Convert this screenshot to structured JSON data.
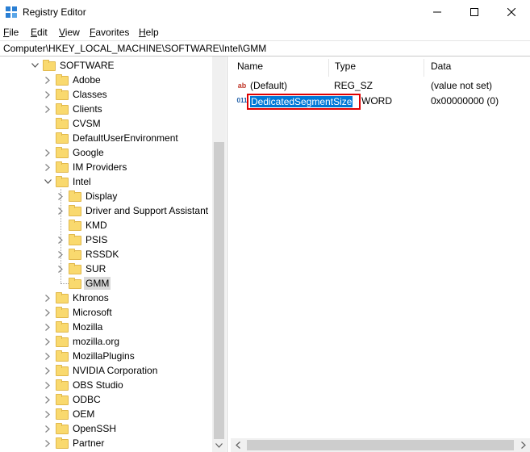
{
  "window": {
    "title": "Registry Editor",
    "controls": {
      "minimize": "minimize",
      "maximize": "maximize",
      "close": "close"
    }
  },
  "menu": [
    {
      "label": "File"
    },
    {
      "label": "Edit"
    },
    {
      "label": "View"
    },
    {
      "label": "Favorites"
    },
    {
      "label": "Help"
    }
  ],
  "address": "Computer\\HKEY_LOCAL_MACHINE\\SOFTWARE\\Intel\\GMM",
  "tree": {
    "items": [
      {
        "label": "SOFTWARE",
        "expanded": true
      },
      {
        "label": "Adobe"
      },
      {
        "label": "Classes"
      },
      {
        "label": "Clients"
      },
      {
        "label": "CVSM"
      },
      {
        "label": "DefaultUserEnvironment"
      },
      {
        "label": "Google"
      },
      {
        "label": "IM Providers"
      },
      {
        "label": "Intel",
        "expanded": true
      },
      {
        "label": "Display"
      },
      {
        "label": "Driver and Support Assistant"
      },
      {
        "label": "KMD"
      },
      {
        "label": "PSIS"
      },
      {
        "label": "RSSDK"
      },
      {
        "label": "SUR"
      },
      {
        "label": "GMM",
        "selected": true
      },
      {
        "label": "Khronos"
      },
      {
        "label": "Microsoft"
      },
      {
        "label": "Mozilla"
      },
      {
        "label": "mozilla.org"
      },
      {
        "label": "MozillaPlugins"
      },
      {
        "label": "NVIDIA Corporation"
      },
      {
        "label": "OBS Studio"
      },
      {
        "label": "ODBC"
      },
      {
        "label": "OEM"
      },
      {
        "label": "OpenSSH"
      },
      {
        "label": "Partner"
      }
    ]
  },
  "list": {
    "columns": {
      "name": "Name",
      "type": "Type",
      "data": "Data"
    },
    "rows": [
      {
        "icon": "string-value-icon",
        "name": "(Default)",
        "type": "REG_SZ",
        "data": "(value not set)"
      },
      {
        "icon": "dword-value-icon",
        "name": "DedicatedSegmentSize",
        "type": "WORD",
        "data": "0x00000000 (0)",
        "editing": true
      }
    ]
  },
  "colors": {
    "selection": "#0078d7",
    "highlight_box": "#e00000",
    "folder": "#f9d96e",
    "tree_selected": "#d9d9d9"
  }
}
